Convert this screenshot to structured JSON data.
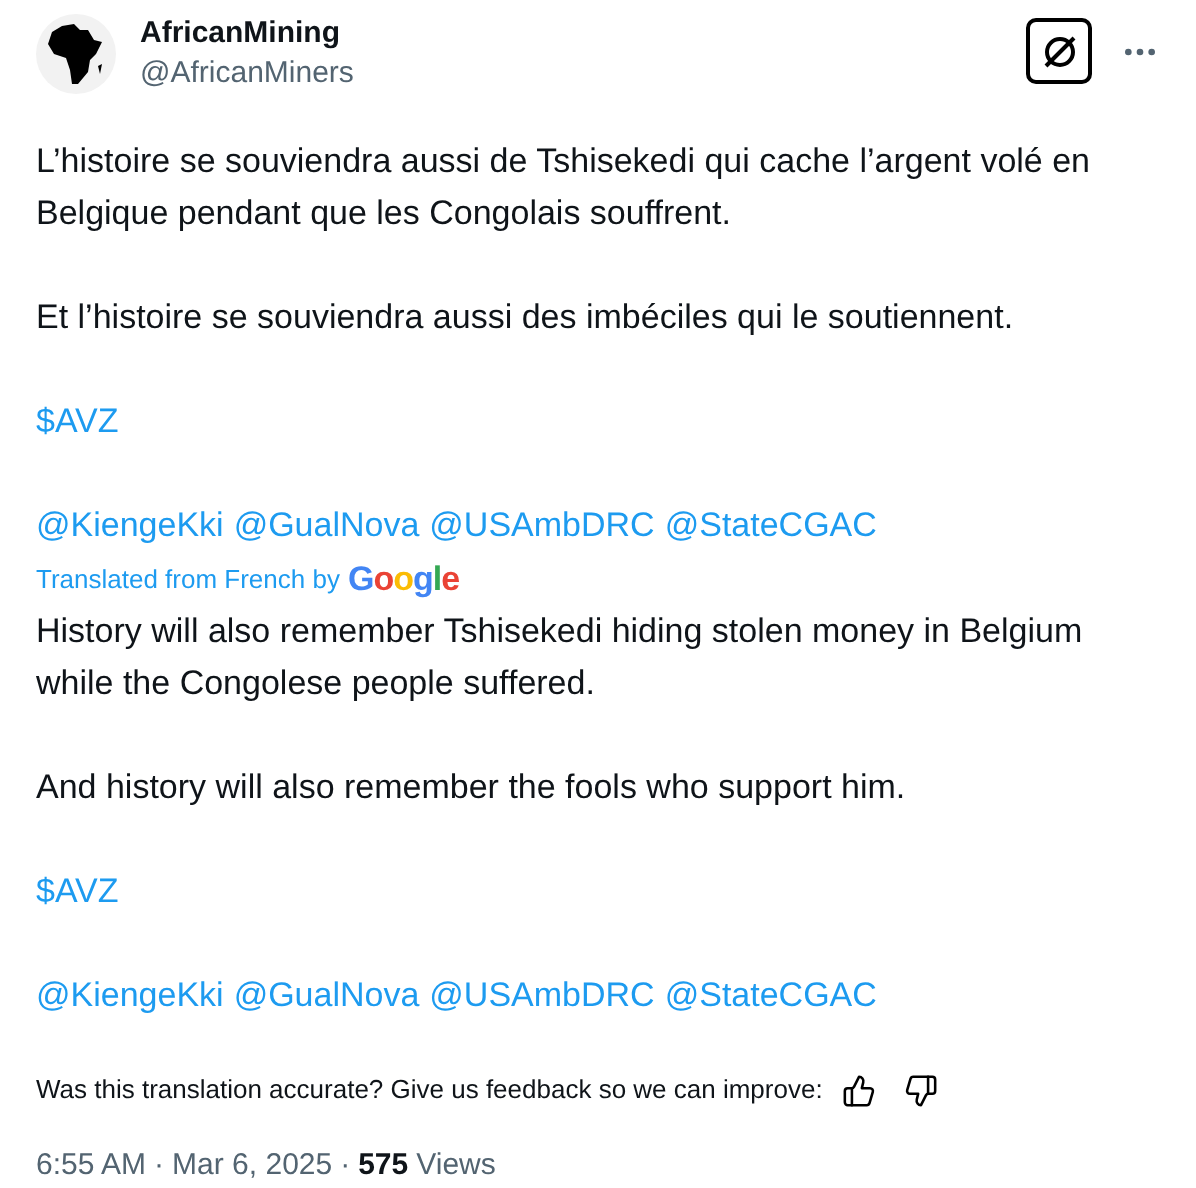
{
  "author": {
    "name": "AfricanMining",
    "handle": "@AfricanMiners"
  },
  "original": {
    "paragraphs": [
      "L’histoire se souviendra aussi de Tshisekedi qui cache l’argent volé en Belgique pendant que les Congolais souffrent.",
      "Et l’histoire se souviendra aussi des imbéciles qui le soutiennent."
    ],
    "cashtag": "$AVZ",
    "mentions": [
      "@KiengeKki",
      "@GualNova",
      "@USAmbDRC",
      "@StateCGAC"
    ]
  },
  "translation_note": {
    "text": "Translated from French by",
    "brand": "Google"
  },
  "translated": {
    "paragraphs": [
      "History will also remember Tshisekedi hiding stolen money in Belgium while the Congolese people suffered.",
      "And history will also remember the fools who support him."
    ],
    "cashtag": "$AVZ",
    "mentions": [
      "@KiengeKki",
      "@GualNova",
      "@USAmbDRC",
      "@StateCGAC"
    ]
  },
  "feedback": "Was this translation accurate? Give us feedback so we can improve:",
  "meta": {
    "time": "6:55 AM",
    "date": "Mar 6, 2025",
    "views_count": "575",
    "views_label": "Views",
    "separator": "·"
  }
}
